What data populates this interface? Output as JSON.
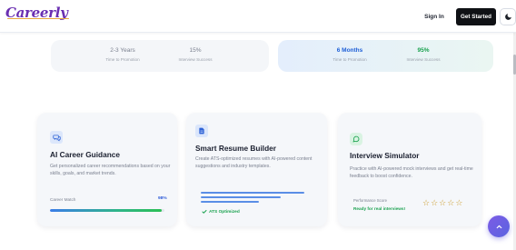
{
  "header": {
    "logo": "Careerly",
    "sign_in": "Sign In",
    "get_started": "Get Started"
  },
  "stats": {
    "before": [
      {
        "value": "2-3 Years",
        "label": "Time to Promotion"
      },
      {
        "value": "15%",
        "label": "Interview Success"
      }
    ],
    "after": [
      {
        "value": "6 Months",
        "label": "Time to Promotion"
      },
      {
        "value": "95%",
        "label": "Interview Success"
      }
    ]
  },
  "features": [
    {
      "title": "AI Career Guidance",
      "description": "Get personalized career recommendations based on your skills, goals, and market trends.",
      "meter_label": "Career Match",
      "meter_value": "98%",
      "meter_fraction": 0.98
    },
    {
      "title": "Smart Resume Builder",
      "description": "Create ATS-optimized resumes with AI-powered content suggestions and industry templates.",
      "badge": "ATS Optimized"
    },
    {
      "title": "Interview Simulator",
      "description": "Practice with AI-powered mock interviews and get real-time feedback to boost confidence.",
      "score_label": "Performance Score",
      "score_status": "Ready for real interviews!",
      "stars": 5
    }
  ],
  "icons": {
    "theme_toggle": "moon-icon",
    "card1": "chat-bubbles-icon",
    "card2": "document-icon",
    "card3": "message-circle-icon",
    "fab": "chevron-up-icon"
  },
  "colors": {
    "brand": "#6a2fb1",
    "accent_blue": "#1e5fd7",
    "accent_green": "#1aa24f",
    "star": "#c9961e"
  }
}
